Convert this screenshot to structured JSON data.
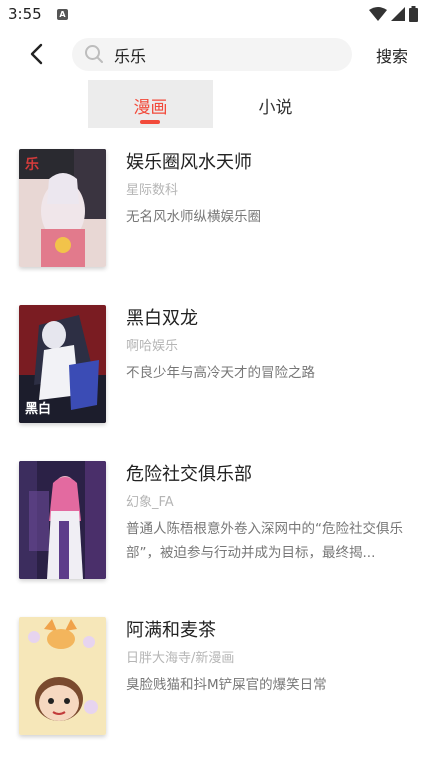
{
  "status_bar": {
    "time": "3:55",
    "notification_icon": "a-letter-icon",
    "right_icons": [
      "wifi-icon",
      "signal-icon",
      "battery-icon"
    ]
  },
  "header": {
    "back_icon": "back-arrow-icon",
    "search_icon": "search-icon",
    "search_value": "乐乐",
    "search_button": "搜索"
  },
  "tabs": [
    {
      "label": "漫画",
      "active": true
    },
    {
      "label": "小说",
      "active": false
    }
  ],
  "accent_color": "#f24a3a",
  "results": [
    {
      "title": "娱乐圈风水天师",
      "author": "星际数科",
      "description": "无名风水师纵横娱乐圈"
    },
    {
      "title": "黑白双龙",
      "author": "啊哈娱乐",
      "description": "不良少年与高冷天才的冒险之路"
    },
    {
      "title": "危险社交俱乐部",
      "author": "幻象_FA",
      "description": "普通人陈梧根意外卷入深网中的“危险社交俱乐部”，被迫参与行动并成为目标，最终揭..."
    },
    {
      "title": "阿满和麦茶",
      "author": "日胖大海寺/新漫画",
      "description": "臭脸贱猫和抖M铲屎官的爆笑日常"
    }
  ]
}
